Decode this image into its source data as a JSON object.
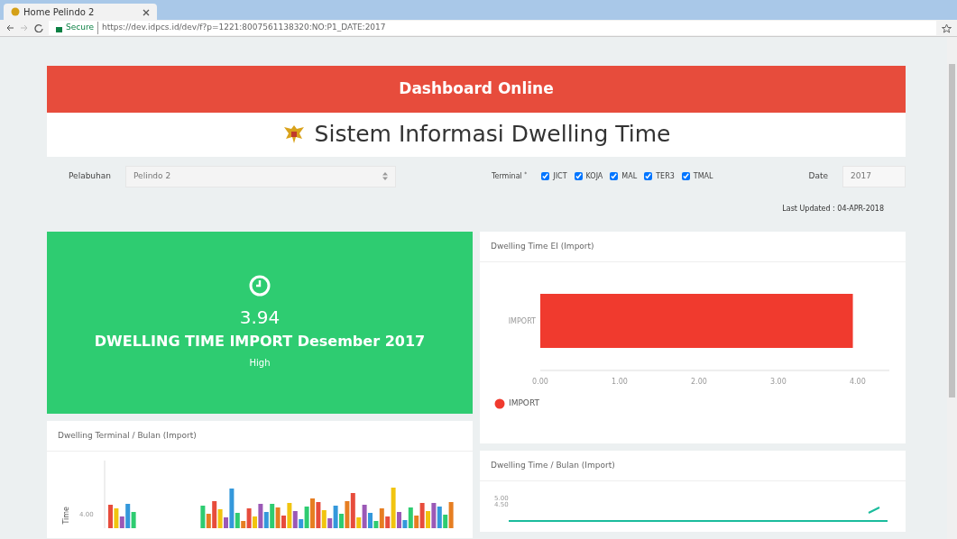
{
  "browser": {
    "tab_title": "Home Pelindo 2",
    "secure_label": "Secure",
    "url": "https://dev.idpcs.id/dev/f?p=1221:8007561138320:NO:P1_DATE:2017"
  },
  "header": {
    "banner": "Dashboard Online",
    "title": "Sistem Informasi Dwelling Time"
  },
  "filters": {
    "port_label": "Pelabuhan",
    "port_value": "Pelindo 2",
    "terminal_label": "Terminal",
    "required_mark": "*",
    "terminals": [
      {
        "label": "JICT",
        "checked": true
      },
      {
        "label": "KOJA",
        "checked": true
      },
      {
        "label": "MAL",
        "checked": true
      },
      {
        "label": "TER3",
        "checked": true
      },
      {
        "label": "TMAL",
        "checked": true
      }
    ],
    "date_label": "Date",
    "date_value": "2017"
  },
  "last_updated": "Last Updated : 04-APR-2018",
  "summary": {
    "value": "3.94",
    "caption": "DWELLING TIME IMPORT Desember 2017",
    "level_text": "High"
  },
  "dwelling_chart": {
    "title": "Dwelling Time EI (Import)",
    "chart_data": {
      "type": "bar",
      "orientation": "horizontal",
      "categories": [
        "IMPORT"
      ],
      "series": [
        {
          "name": "IMPORT",
          "color": "#f03a2e",
          "values": [
            3.94
          ]
        }
      ],
      "xlim": [
        0,
        4.4
      ],
      "xticks": [
        {
          "value": 0,
          "label": "0.00"
        },
        {
          "value": 1,
          "label": "1.00"
        },
        {
          "value": 2,
          "label": "2.00"
        },
        {
          "value": 3,
          "label": "3.00"
        },
        {
          "value": 4,
          "label": "4.00"
        }
      ]
    }
  },
  "terminal_chart": {
    "title": "Dwelling Terminal / Bulan (Import)",
    "ylabel": "Time",
    "ytick": "4.00"
  },
  "monthly_chart": {
    "title": "Dwelling Time / Bulan (Import)",
    "yticks": [
      "5.00",
      "4.50"
    ]
  }
}
